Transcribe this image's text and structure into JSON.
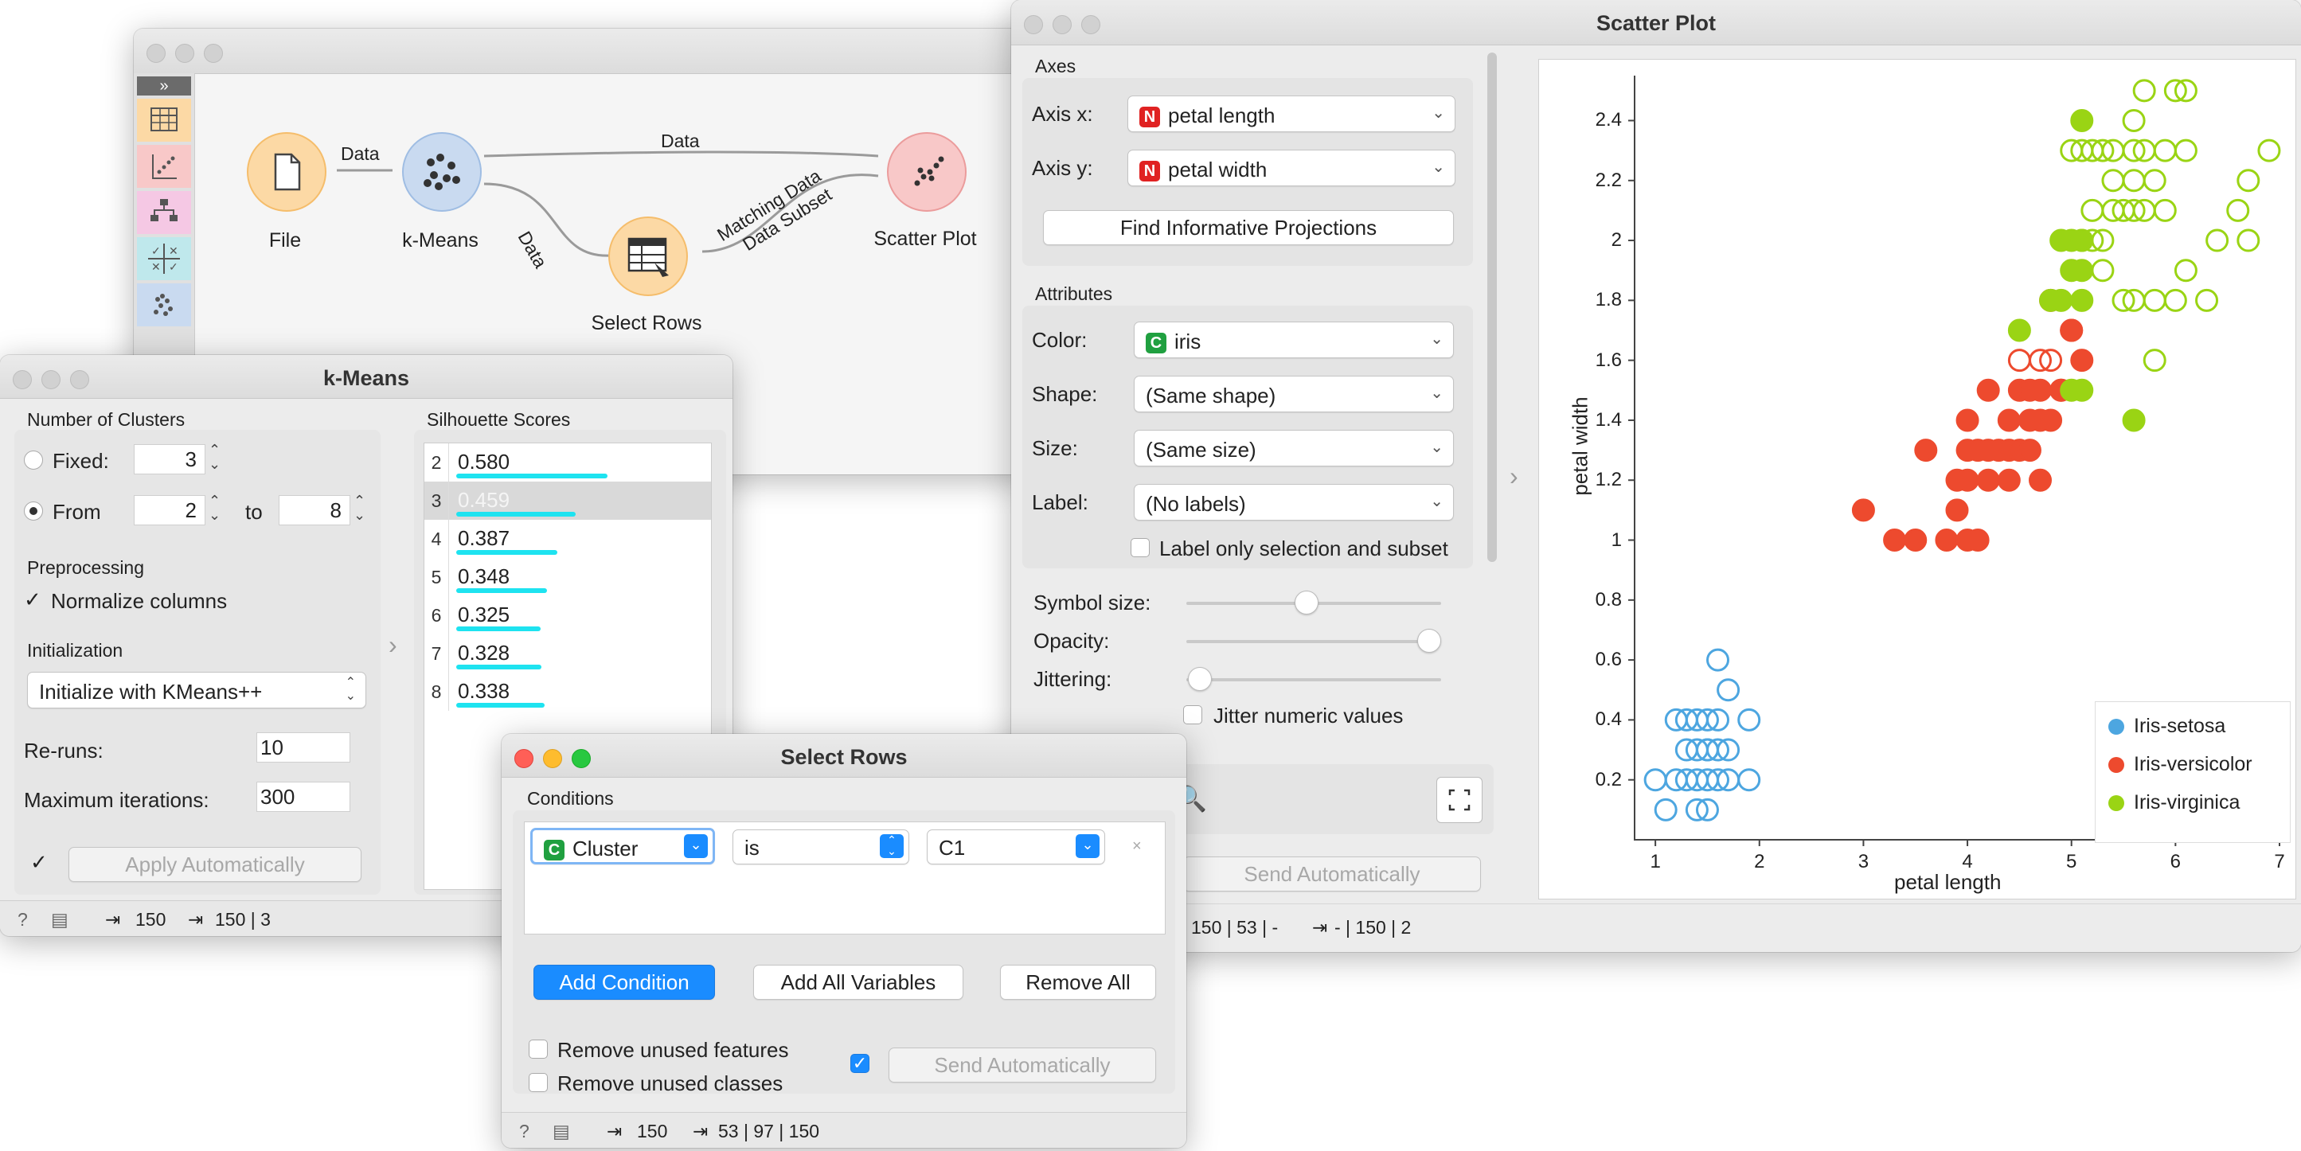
{
  "canvas": {
    "nodes": [
      {
        "label": "File",
        "icon": "file-icon",
        "color": "#fcd9a5"
      },
      {
        "label": "k-Means",
        "icon": "kmeans-icon",
        "color": "#c9daf0"
      },
      {
        "label": "Select Rows",
        "icon": "select-rows-icon",
        "color": "#fcd9a5"
      },
      {
        "label": "Scatter Plot",
        "icon": "scatter-plot-icon",
        "color": "#f8c8c8"
      }
    ],
    "links": {
      "file_kmeans": "Data",
      "kmeans_scatter": "Data",
      "kmeans_select": "Data",
      "select_scatter_1": "Matching Data",
      "select_scatter_2": "Data Subset"
    },
    "toolbox_icons": [
      "expand-icon",
      "data-table-icon",
      "scatter-icon",
      "tree-icon",
      "confusion-icon",
      "cluster-icon"
    ]
  },
  "kmeans": {
    "title": "k-Means",
    "num_clusters_label": "Number of Clusters",
    "fixed_label": "Fixed:",
    "fixed_value": "3",
    "from_label": "From",
    "from_value": "2",
    "to_label": "to",
    "to_value": "8",
    "preprocessing_label": "Preprocessing",
    "normalize_label": "Normalize columns",
    "initialization_label": "Initialization",
    "init_method": "Initialize with KMeans++",
    "reruns_label": "Re-runs:",
    "reruns_value": "10",
    "max_iter_label": "Maximum iterations:",
    "max_iter_value": "300",
    "apply_label": "Apply Automatically",
    "silhouette_label": "Silhouette Scores",
    "scores": [
      {
        "k": "2",
        "value": "0.580",
        "score": 0.58
      },
      {
        "k": "3",
        "value": "0.459",
        "score": 0.459
      },
      {
        "k": "4",
        "value": "0.387",
        "score": 0.387
      },
      {
        "k": "5",
        "value": "0.348",
        "score": 0.348
      },
      {
        "k": "6",
        "value": "0.325",
        "score": 0.325
      },
      {
        "k": "7",
        "value": "0.328",
        "score": 0.328
      },
      {
        "k": "8",
        "value": "0.338",
        "score": 0.338
      }
    ],
    "selected_k": "3",
    "status_in": "150",
    "status_out": "150 | 3"
  },
  "select_rows": {
    "title": "Select Rows",
    "conditions_label": "Conditions",
    "condition": {
      "variable": "Cluster",
      "operator": "is",
      "value": "C1"
    },
    "add_condition": "Add Condition",
    "add_all_variables": "Add All Variables",
    "remove_all": "Remove All",
    "remove_unused_features": "Remove unused features",
    "remove_unused_classes": "Remove unused classes",
    "send_automatically": "Send Automatically",
    "status_in": "150",
    "status_out": "53 | 97 | 150"
  },
  "scatter": {
    "title": "Scatter Plot",
    "axes_label": "Axes",
    "axis_x_label": "Axis x:",
    "axis_x_value": "petal length",
    "axis_y_label": "Axis y:",
    "axis_y_value": "petal width",
    "find_projections": "Find Informative Projections",
    "attributes_label": "Attributes",
    "color_label": "Color:",
    "color_value": "iris",
    "shape_label": "Shape:",
    "shape_value": "(Same shape)",
    "size_label": "Size:",
    "size_value": "(Same size)",
    "label_label": "Label:",
    "label_value": "(No labels)",
    "label_only_selection": "Label only selection and subset",
    "symbol_size_label": "Symbol size:",
    "opacity_label": "Opacity:",
    "jittering_label": "Jittering:",
    "jitter_numeric": "Jitter numeric values",
    "send_automatically": "Send Automatically",
    "status_in": "150 | 53 | -",
    "status_out": "- | 150 | 2",
    "badge_numeric": "N",
    "badge_categorical": "C"
  },
  "colors": {
    "setosa": "#4da6e0",
    "versicolor": "#ed4a2e",
    "virginica": "#9ad414",
    "accent": "#1a8cff",
    "badge_numeric": "#e02222",
    "badge_categorical": "#20a040"
  },
  "chart_data": {
    "type": "scatter",
    "xlabel": "petal length",
    "ylabel": "petal width",
    "xlim": [
      0.8,
      7.0
    ],
    "ylim": [
      0.0,
      2.55
    ],
    "xticks": [
      "1",
      "2",
      "3",
      "4",
      "5",
      "6",
      "7"
    ],
    "yticks": [
      "0.2",
      "0.4",
      "0.6",
      "0.8",
      "1",
      "1.2",
      "1.4",
      "1.6",
      "1.8",
      "2",
      "2.2",
      "2.4"
    ],
    "legend_position": "bottom-right",
    "series": [
      {
        "name": "Iris-setosa",
        "color": "#4da6e0",
        "filled": false,
        "points": [
          [
            1.0,
            0.2
          ],
          [
            1.1,
            0.1
          ],
          [
            1.2,
            0.2
          ],
          [
            1.3,
            0.2
          ],
          [
            1.3,
            0.3
          ],
          [
            1.3,
            0.4
          ],
          [
            1.4,
            0.1
          ],
          [
            1.4,
            0.2
          ],
          [
            1.4,
            0.3
          ],
          [
            1.5,
            0.1
          ],
          [
            1.5,
            0.2
          ],
          [
            1.5,
            0.3
          ],
          [
            1.5,
            0.4
          ],
          [
            1.6,
            0.2
          ],
          [
            1.6,
            0.4
          ],
          [
            1.6,
            0.6
          ],
          [
            1.7,
            0.2
          ],
          [
            1.7,
            0.3
          ],
          [
            1.7,
            0.5
          ],
          [
            1.9,
            0.2
          ],
          [
            1.9,
            0.4
          ],
          [
            1.2,
            0.4
          ],
          [
            1.6,
            0.3
          ],
          [
            1.4,
            0.4
          ],
          [
            1.5,
            0.3
          ]
        ]
      },
      {
        "name": "Iris-versicolor",
        "color": "#ed4a2e",
        "filled": true,
        "points": [
          [
            3.0,
            1.1
          ],
          [
            3.3,
            1.0
          ],
          [
            3.5,
            1.0
          ],
          [
            3.6,
            1.3
          ],
          [
            3.8,
            1.0
          ],
          [
            3.9,
            1.1
          ],
          [
            3.9,
            1.2
          ],
          [
            4.0,
            1.0
          ],
          [
            4.0,
            1.2
          ],
          [
            4.0,
            1.3
          ],
          [
            4.1,
            1.0
          ],
          [
            4.1,
            1.3
          ],
          [
            4.2,
            1.2
          ],
          [
            4.2,
            1.3
          ],
          [
            4.2,
            1.5
          ],
          [
            4.3,
            1.3
          ],
          [
            4.4,
            1.2
          ],
          [
            4.4,
            1.3
          ],
          [
            4.4,
            1.4
          ],
          [
            4.5,
            1.3
          ],
          [
            4.5,
            1.5
          ],
          [
            4.6,
            1.3
          ],
          [
            4.6,
            1.4
          ],
          [
            4.6,
            1.5
          ],
          [
            4.7,
            1.2
          ],
          [
            4.7,
            1.4
          ],
          [
            4.7,
            1.5
          ],
          [
            4.8,
            1.4
          ],
          [
            4.9,
            1.5
          ],
          [
            5.0,
            1.7
          ],
          [
            5.1,
            1.6
          ],
          [
            4.0,
            1.4
          ]
        ]
      },
      {
        "name": "Iris-versicolor",
        "color": "#ed4a2e",
        "filled": false,
        "points": [
          [
            4.5,
            1.6
          ],
          [
            4.8,
            1.8
          ],
          [
            4.8,
            1.6
          ],
          [
            5.0,
            1.7
          ],
          [
            4.9,
            1.5
          ],
          [
            4.7,
            1.6
          ]
        ]
      },
      {
        "name": "Iris-virginica",
        "color": "#9ad414",
        "filled": true,
        "points": [
          [
            4.5,
            1.7
          ],
          [
            4.8,
            1.8
          ],
          [
            4.9,
            1.8
          ],
          [
            4.9,
            2.0
          ],
          [
            5.0,
            1.5
          ],
          [
            5.0,
            1.9
          ],
          [
            5.0,
            2.0
          ],
          [
            5.1,
            1.8
          ],
          [
            5.1,
            1.9
          ],
          [
            5.1,
            2.0
          ],
          [
            5.1,
            2.4
          ],
          [
            5.6,
            1.4
          ],
          [
            5.1,
            1.5
          ]
        ]
      },
      {
        "name": "Iris-virginica",
        "color": "#9ad414",
        "filled": false,
        "points": [
          [
            5.0,
            2.3
          ],
          [
            5.1,
            2.3
          ],
          [
            5.1,
            2.0
          ],
          [
            5.2,
            2.0
          ],
          [
            5.2,
            2.3
          ],
          [
            5.3,
            1.9
          ],
          [
            5.3,
            2.3
          ],
          [
            5.4,
            2.1
          ],
          [
            5.4,
            2.3
          ],
          [
            5.5,
            1.8
          ],
          [
            5.5,
            2.1
          ],
          [
            5.6,
            1.8
          ],
          [
            5.6,
            2.1
          ],
          [
            5.6,
            2.2
          ],
          [
            5.6,
            2.4
          ],
          [
            5.7,
            2.1
          ],
          [
            5.7,
            2.3
          ],
          [
            5.7,
            2.5
          ],
          [
            5.8,
            1.6
          ],
          [
            5.8,
            1.8
          ],
          [
            5.8,
            2.2
          ],
          [
            5.9,
            2.1
          ],
          [
            5.9,
            2.3
          ],
          [
            6.0,
            1.8
          ],
          [
            6.0,
            2.5
          ],
          [
            6.1,
            1.9
          ],
          [
            6.1,
            2.3
          ],
          [
            6.1,
            2.5
          ],
          [
            6.3,
            1.8
          ],
          [
            6.4,
            2.0
          ],
          [
            6.6,
            2.1
          ],
          [
            6.7,
            2.0
          ],
          [
            6.7,
            2.2
          ],
          [
            6.9,
            2.3
          ],
          [
            5.4,
            2.2
          ],
          [
            5.3,
            2.0
          ],
          [
            5.6,
            2.3
          ],
          [
            5.2,
            2.1
          ]
        ]
      }
    ],
    "legend": [
      {
        "name": "Iris-setosa",
        "color": "#4da6e0"
      },
      {
        "name": "Iris-versicolor",
        "color": "#ed4a2e"
      },
      {
        "name": "Iris-virginica",
        "color": "#9ad414"
      }
    ]
  }
}
